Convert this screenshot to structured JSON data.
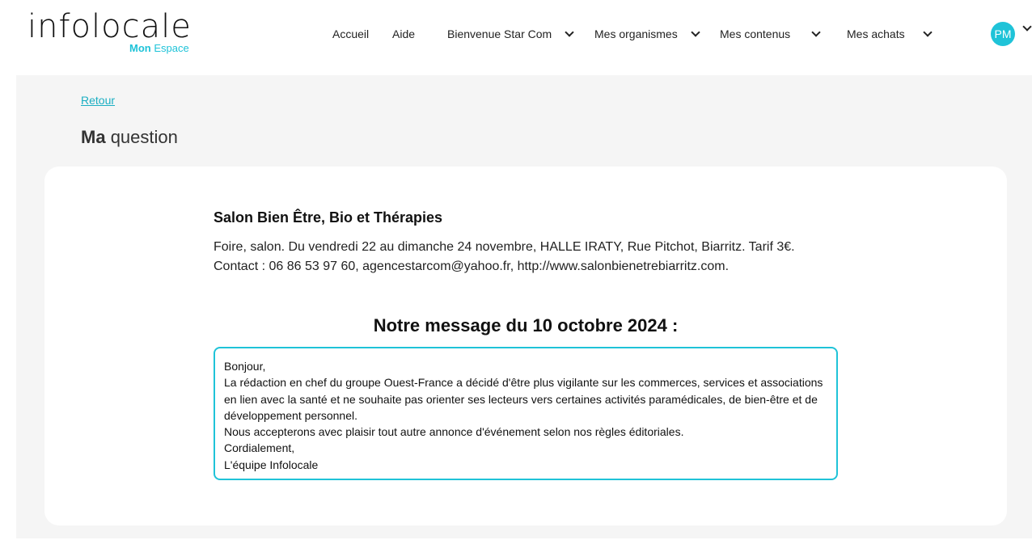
{
  "header": {
    "logo_main": "infolocale",
    "logo_sub_bold": "Mon",
    "logo_sub": "Espace",
    "nav": [
      "Accueil",
      "Aide",
      "Bienvenue Star Com",
      "Mes organismes",
      "Mes contenus",
      "Mes achats"
    ],
    "avatar": "PM"
  },
  "page": {
    "back": "Retour",
    "title_bold": "Ma",
    "title": "question"
  },
  "event": {
    "title": "Salon Bien Être, Bio et Thérapies",
    "line1": "Foire, salon. Du vendredi 22 au dimanche 24 novembre, HALLE IRATY, Rue Pitchot, Biarritz. Tarif 3€.",
    "line2": "Contact : 06 86 53 97 60, agencestarcom@yahoo.fr, http://www.salonbienetrebiarritz.com."
  },
  "message": {
    "title": "Notre message du 10 octobre 2024 :",
    "lines": [
      "Bonjour,",
      "La rédaction en chef du groupe Ouest-France a décidé d'être plus vigilante sur les commerces, services et associations en lien avec la santé et ne souhaite pas orienter ses lecteurs vers certaines activités paramédicales, de bien-être et de développement personnel.",
      "Nous accepterons avec plaisir tout autre annonce d'événement selon nos règles éditoriales.",
      "Cordialement,",
      "L'équipe Infolocale"
    ]
  }
}
